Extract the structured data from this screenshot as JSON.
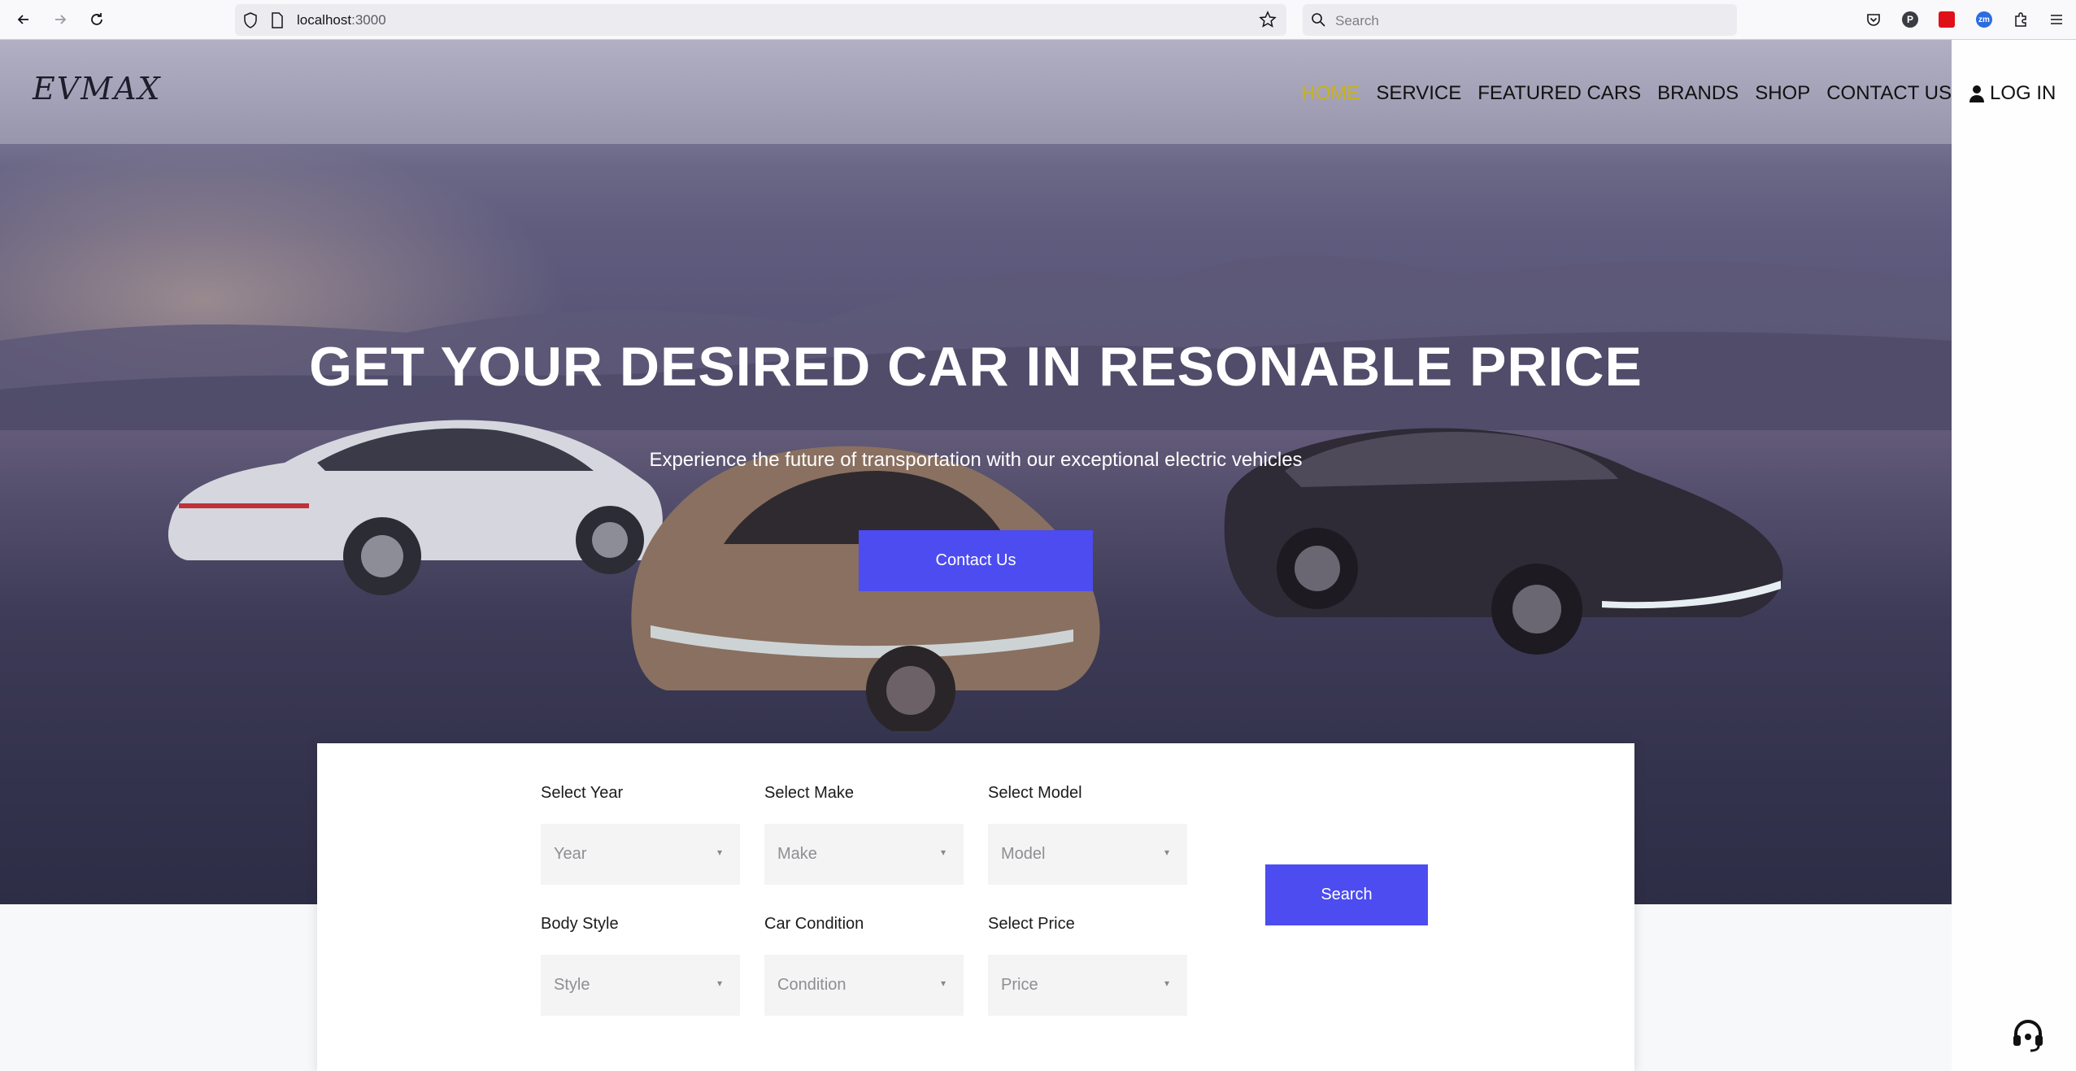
{
  "browser": {
    "url_host": "localhost",
    "url_port": ":3000",
    "search_placeholder": "Search"
  },
  "site": {
    "logo": "EVMAX",
    "menu": [
      {
        "label": "HOME",
        "active": true
      },
      {
        "label": "SERVICE",
        "active": false
      },
      {
        "label": "FEATURED CARS",
        "active": false
      },
      {
        "label": "BRANDS",
        "active": false
      },
      {
        "label": "SHOP",
        "active": false
      },
      {
        "label": "CONTACT US",
        "active": false
      }
    ],
    "login": "LOG IN",
    "active_color": "#c9b21b"
  },
  "hero": {
    "title": "GET YOUR DESIRED CAR IN RESONABLE PRICE",
    "subtitle": "Experience the future of transportation with our exceptional electric vehicles",
    "cta": "Contact Us",
    "accent": "#4c4cf0"
  },
  "search_form": {
    "fields": [
      {
        "label": "Select Year",
        "placeholder": "Year"
      },
      {
        "label": "Select Make",
        "placeholder": "Make"
      },
      {
        "label": "Select Model",
        "placeholder": "Model"
      },
      {
        "label": "Body Style",
        "placeholder": "Style"
      },
      {
        "label": "Car Condition",
        "placeholder": "Condition"
      },
      {
        "label": "Select Price",
        "placeholder": "Price"
      }
    ],
    "button": "Search"
  },
  "icons": [
    "back-icon",
    "forward-icon",
    "reload-icon",
    "shield-icon",
    "page-icon",
    "bookmark-star-icon",
    "search-icon",
    "pocket-icon",
    "extension-p-icon",
    "extension-red-icon",
    "extension-zoom-icon",
    "extensions-icon",
    "menu-icon",
    "user-icon",
    "headset-icon",
    "select-arrow-icon"
  ]
}
